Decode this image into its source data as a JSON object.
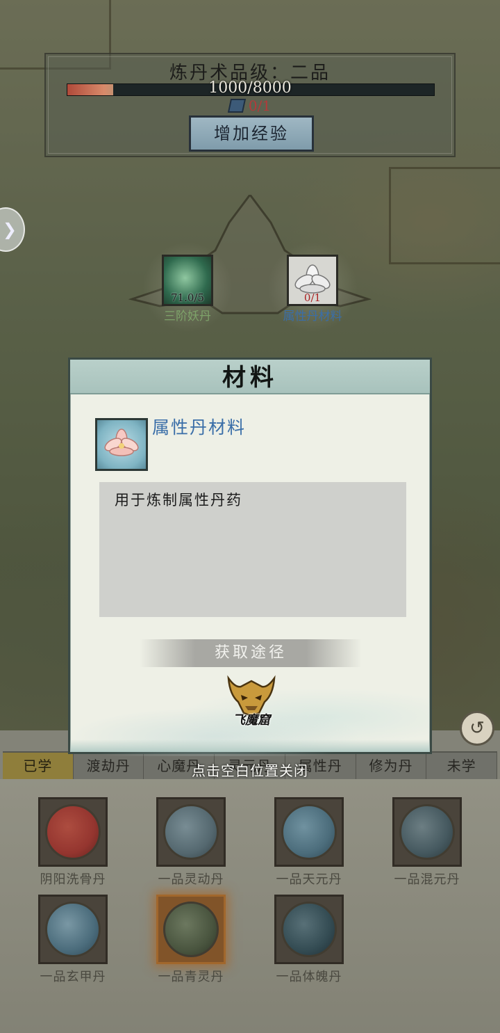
{
  "alchemy": {
    "title": "炼丹术品级：二品",
    "exp_text": "1000/8000",
    "exp_progress": 0.125,
    "book_count": "0/1",
    "add_exp_label": "增加经验"
  },
  "ingredients": [
    {
      "count": "71.0/5",
      "label": "三阶妖丹",
      "icon": "green-orb-icon"
    },
    {
      "count": "0/1",
      "label": "属性丹材料",
      "icon": "lotus-icon"
    }
  ],
  "dialog": {
    "title": "材料",
    "item_name": "属性丹材料",
    "item_icon": "lotus-icon",
    "description": "用于炼制属性丹药",
    "source_header": "获取途径",
    "source_label": "飞魔窟",
    "source_icon": "demon-mask-icon"
  },
  "close_hint": "点击空白位置关闭",
  "tabs": [
    "已学",
    "渡劫丹",
    "心魔丹",
    "灵元丹",
    "属性丹",
    "修为丹",
    "未学"
  ],
  "active_tab": 0,
  "pills": [
    {
      "name": "阴阳洗骨丹",
      "color": "#c0413a"
    },
    {
      "name": "一品灵动丹",
      "color": "#6b8590"
    },
    {
      "name": "一品天元丹",
      "color": "#5f8ba0"
    },
    {
      "name": "一品混元丹",
      "color": "#56707a"
    },
    {
      "name": "一品玄甲丹",
      "color": "#5e8aa0"
    },
    {
      "name": "一品青灵丹",
      "color": "#5c6b4f",
      "selected": true
    },
    {
      "name": "一品体魄丹",
      "color": "#3f5f6a"
    }
  ]
}
